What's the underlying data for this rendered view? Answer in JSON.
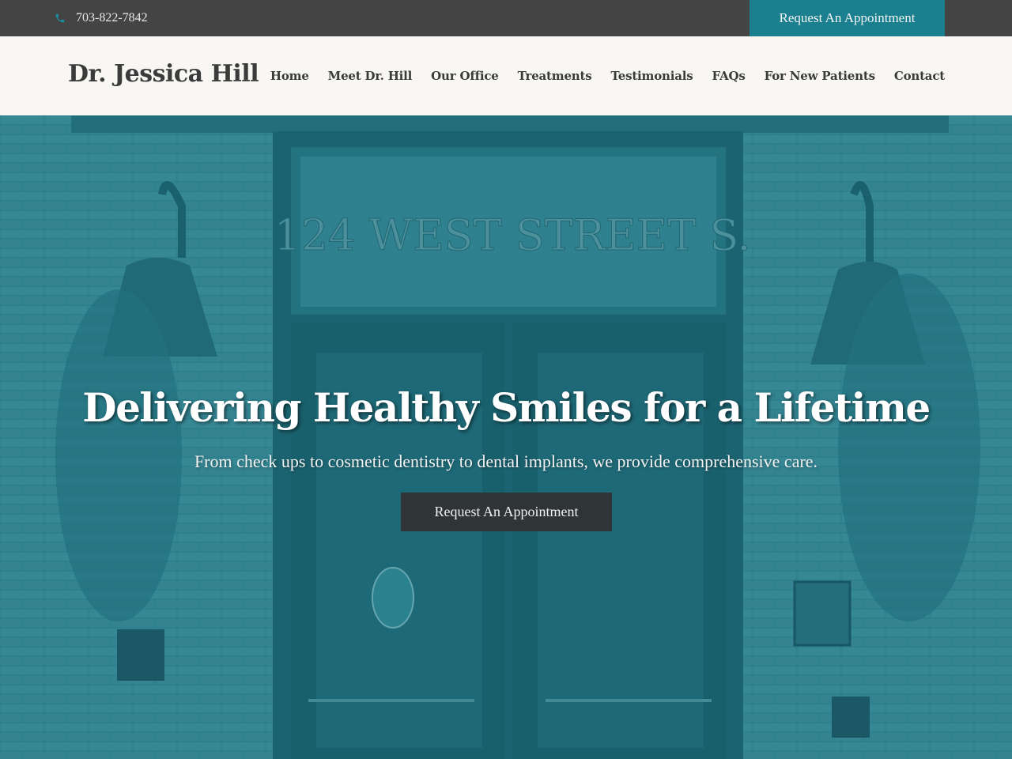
{
  "topbar": {
    "phone_icon": "phone-icon",
    "phone": "703-822-7842",
    "appointment_label": "Request An Appointment"
  },
  "header": {
    "logo": "Dr. Jessica Hill",
    "nav": [
      {
        "label": "Home"
      },
      {
        "label": "Meet Dr. Hill"
      },
      {
        "label": "Our Office"
      },
      {
        "label": "Treatments"
      },
      {
        "label": "Testimonials"
      },
      {
        "label": "FAQs"
      },
      {
        "label": "For New Patients"
      },
      {
        "label": "Contact"
      }
    ]
  },
  "hero": {
    "sign_text": "124 WEST STREET S.",
    "title": "Delivering Healthy Smiles for a Lifetime",
    "subtitle": "From check ups to cosmetic dentistry to dental implants, we provide comprehensive care.",
    "button_label": "Request An Appointment"
  },
  "colors": {
    "topbar_bg": "#444444",
    "accent": "#1a7f8e",
    "header_bg": "#f8f7f4",
    "hero_tint": "#2d7c88",
    "hero_button_bg": "#2f3437"
  }
}
